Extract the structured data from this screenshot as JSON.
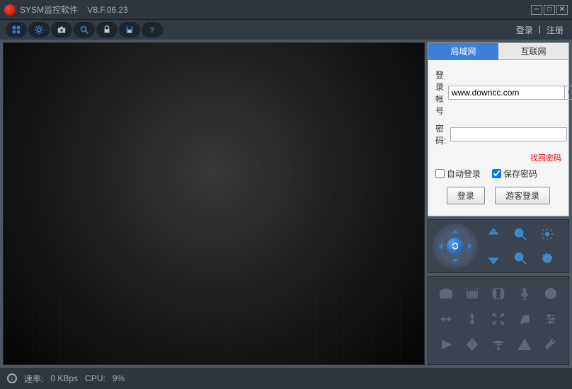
{
  "title": {
    "app_name": "SYSM监控软件",
    "version": "V8.F.06.23"
  },
  "toolbar": {
    "icons": [
      "grid-icon",
      "gear-icon",
      "camera-icon",
      "search-icon",
      "lock-icon",
      "save-icon",
      "help-icon"
    ],
    "login_link": "登录",
    "register_link": "注册",
    "separator": "|"
  },
  "tabs": {
    "lan": "局域网",
    "wan": "互联网"
  },
  "login": {
    "account_label": "登录帐号",
    "account_value": "www.downcc.com",
    "password_label": "密    码:",
    "password_value": "",
    "find_password": "找回密码",
    "auto_login_label": "自动登录",
    "auto_login_checked": false,
    "save_password_label": "保存密码",
    "save_password_checked": true,
    "login_btn": "登录",
    "guest_btn": "游客登录"
  },
  "ptz": {
    "wheel_icons": [
      "ptz-up",
      "ptz-down",
      "ptz-left",
      "ptz-right",
      "ptz-sync"
    ],
    "extra_icons": [
      "zoom-plus-icon",
      "magnify-plus-icon",
      "aperture-open-icon",
      "zoom-minus-icon",
      "magnify-minus-icon",
      "aperture-close-icon"
    ]
  },
  "tools": {
    "icons": [
      "snapshot-icon",
      "record-icon",
      "audio-out-icon",
      "mic-icon",
      "disc-icon",
      "horiz-move-icon",
      "vert-move-icon",
      "expand-icon",
      "return-icon",
      "sliders-icon",
      "play-icon",
      "mirror-icon",
      "wifi-icon",
      "alert-icon",
      "tools-icon"
    ]
  },
  "status": {
    "speed_label": "速率:",
    "speed_value": "0 KBps",
    "cpu_label": "CPU:",
    "cpu_value": "9%"
  }
}
